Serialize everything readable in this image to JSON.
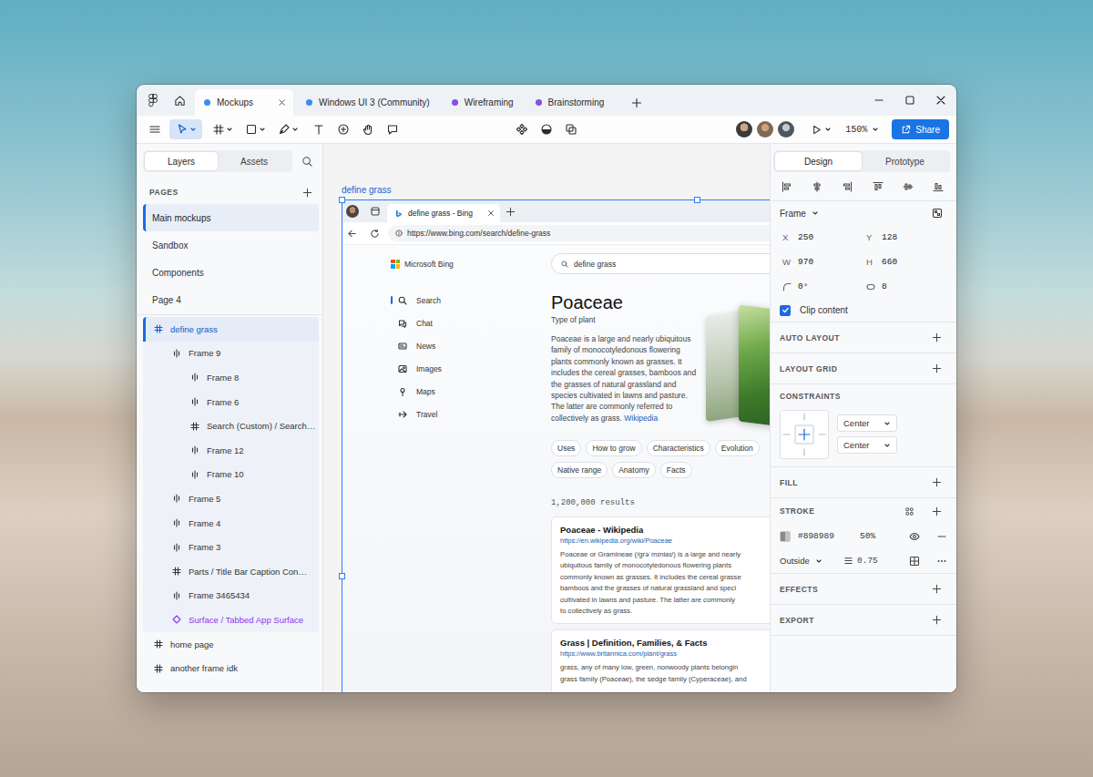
{
  "tabs": [
    {
      "label": "Mockups",
      "selected": true,
      "color": "#3d8bf2"
    },
    {
      "label": "Windows UI 3 (Community)",
      "selected": false,
      "color": "#3d8bf2"
    },
    {
      "label": "Wireframing",
      "selected": false,
      "color": "#8b4be6"
    },
    {
      "label": "Brainstorming",
      "selected": false,
      "color": "#8b4be6"
    }
  ],
  "toolbar": {
    "tools": [
      {
        "selected": true
      },
      {
        "selected": false
      },
      {
        "selected": false
      },
      {
        "selected": false
      },
      {
        "selected": false
      },
      {
        "selected": false
      },
      {
        "selected": false
      },
      {
        "selected": false
      }
    ],
    "zoom": "150%",
    "share": "Share"
  },
  "sidebar": {
    "tabs": [
      {
        "label": "Layers",
        "selected": true
      },
      {
        "label": "Assets",
        "selected": false
      }
    ],
    "pages_title": "PAGES",
    "pages": [
      {
        "label": "Main mockups",
        "selected": true
      },
      {
        "label": "Sandbox",
        "selected": false
      },
      {
        "label": "Components",
        "selected": false
      },
      {
        "label": "Page 4",
        "selected": false
      }
    ],
    "layers": [
      {
        "name": "define grass",
        "kind": "frame",
        "selected": true,
        "children": [
          {
            "name": "Frame 9",
            "kind": "autolayout",
            "selected": false,
            "children": [
              {
                "name": "Frame 8",
                "kind": "autolayout",
                "selected": false,
                "children": []
              },
              {
                "name": "Frame 6",
                "kind": "autolayout",
                "selected": false,
                "children": []
              },
              {
                "name": "Search (Custom) / Search…",
                "kind": "frame",
                "selected": false,
                "children": []
              },
              {
                "name": "Frame 12",
                "kind": "autolayout",
                "selected": false,
                "children": []
              },
              {
                "name": "Frame 10",
                "kind": "autolayout",
                "selected": false,
                "children": []
              }
            ]
          },
          {
            "name": "Frame 5",
            "kind": "autolayout",
            "selected": false,
            "children": []
          },
          {
            "name": "Frame 4",
            "kind": "autolayout",
            "selected": false,
            "children": []
          },
          {
            "name": "Frame 3",
            "kind": "autolayout",
            "selected": false,
            "children": []
          },
          {
            "name": "Parts / Title Bar Caption Con…",
            "kind": "frame",
            "selected": false,
            "children": []
          },
          {
            "name": "Frame 3465434",
            "kind": "autolayout",
            "selected": false,
            "children": []
          },
          {
            "name": "Surface / Tabbed App Surface",
            "kind": "component",
            "selected": false,
            "children": []
          }
        ]
      },
      {
        "name": "home page",
        "kind": "frame",
        "selected": false,
        "children": []
      },
      {
        "name": "another frame idk",
        "kind": "frame",
        "selected": false,
        "children": []
      }
    ]
  },
  "canvas": {
    "frame_label": "define grass",
    "browser": {
      "tab_title": "define grass - Bing",
      "url": "https://www.bing.com/search/define-grass",
      "brand": "Microsoft Bing",
      "query": "define grass",
      "nav": [
        {
          "label": "Search",
          "selected": true
        },
        {
          "label": "Chat",
          "selected": false
        },
        {
          "label": "News",
          "selected": false
        },
        {
          "label": "Images",
          "selected": false
        },
        {
          "label": "Maps",
          "selected": false
        },
        {
          "label": "Travel",
          "selected": false
        }
      ],
      "entity": {
        "title": "Poaceae",
        "subtitle": "Type of plant",
        "description": "Poaceae is a large and nearly ubiquitous family of monocotyledonous flowering plants commonly known as grasses. It includes the cereal grasses, bamboos and the grasses of natural grassland and species cultivated in lawns and pasture. The latter are commonly referred to collectively as grass.",
        "source": "Wikipedia",
        "chips": [
          "Uses",
          "How to grow",
          "Characteristics",
          "Evolution",
          "Native range",
          "Anatomy",
          "Facts"
        ]
      },
      "result_count": "1,200,000 results",
      "results": [
        {
          "title": "Poaceae - Wikipedia",
          "url": "https://en.wikipedia.org/wiki/Poaceae",
          "snippet_lines": [
            "Poaceae or Gramineae (/ɡrəˈmɪniaɪ/) is a large and nearly",
            "ubiquitous family of monocotyledonous flowering plants",
            "commonly known as grasses. It includes the cereal grasse",
            "bamboos and the grasses of natural grassland and speci",
            "cultivated in lawns and pasture. The latter are commonly",
            "to collectively as grass."
          ]
        },
        {
          "title": "Grass | Definition, Families, & Facts",
          "url": "https://www.britannica.com/plant/grass",
          "snippet_lines": [
            "grass, any of many low, green, nonwoody plants belongin",
            "grass family (Poaceae), the sedge family (Cyperaceae), and"
          ]
        }
      ]
    }
  },
  "design": {
    "tabs": [
      {
        "label": "Design",
        "selected": true
      },
      {
        "label": "Prototype",
        "selected": false
      }
    ],
    "layer_type": "Frame",
    "fields": [
      {
        "label": "X",
        "value": "250"
      },
      {
        "label": "Y",
        "value": "128"
      },
      {
        "label": "W",
        "value": "970"
      },
      {
        "label": "H",
        "value": "660"
      }
    ],
    "rotation": "0°",
    "radius": "8",
    "clip_content": {
      "label": "Clip content",
      "checked": true
    },
    "sections": [
      {
        "title": "AUTO LAYOUT",
        "kind": "empty"
      },
      {
        "title": "LAYOUT GRID",
        "kind": "empty"
      },
      {
        "title": "CONSTRAINTS",
        "kind": "constraints",
        "horizontal": "Center",
        "vertical": "Center"
      },
      {
        "title": "FILL",
        "kind": "empty"
      },
      {
        "title": "STROKE",
        "kind": "stroke",
        "color": "#898989",
        "opacity": "50%",
        "visible": true,
        "position": "Outside",
        "weight": "0.75"
      },
      {
        "title": "EFFECTS",
        "kind": "empty"
      },
      {
        "title": "EXPORT",
        "kind": "empty"
      }
    ]
  }
}
